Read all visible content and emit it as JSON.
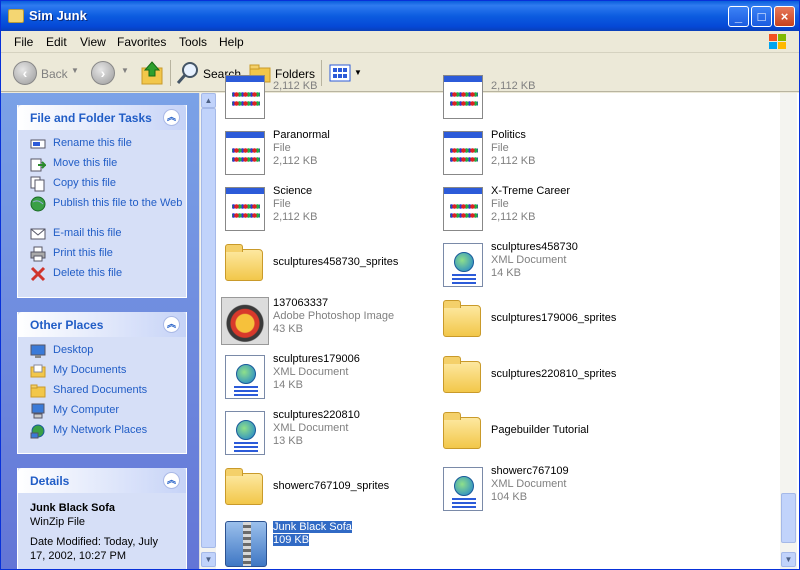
{
  "window": {
    "title": "Sim Junk"
  },
  "menu": [
    "File",
    "Edit",
    "View",
    "Favorites",
    "Tools",
    "Help"
  ],
  "toolbar": {
    "back": "Back",
    "search": "Search",
    "folders": "Folders"
  },
  "tasks_panel": {
    "title": "File and Folder Tasks",
    "items": [
      "Rename this file",
      "Move this file",
      "Copy this file",
      "Publish this file to the Web",
      "E-mail this file",
      "Print this file",
      "Delete this file"
    ]
  },
  "places_panel": {
    "title": "Other Places",
    "items": [
      "Desktop",
      "My Documents",
      "Shared Documents",
      "My Computer",
      "My Network Places"
    ]
  },
  "details_panel": {
    "title": "Details",
    "name": "Junk Black Sofa",
    "type": "WinZip File",
    "modified": "Date Modified: Today, July 17, 2002, 10:27 PM"
  },
  "files": [
    {
      "name": "",
      "type": "",
      "size": "2,112 KB",
      "icon": "exe-icon"
    },
    {
      "name": "",
      "type": "",
      "size": "2,112 KB",
      "icon": "exe-icon"
    },
    {
      "name": "Paranormal",
      "type": "File",
      "size": "2,112 KB",
      "icon": "exe-icon"
    },
    {
      "name": "Politics",
      "type": "File",
      "size": "2,112 KB",
      "icon": "exe-icon"
    },
    {
      "name": "Science",
      "type": "File",
      "size": "2,112 KB",
      "icon": "exe-icon"
    },
    {
      "name": "X-Treme Career",
      "type": "File",
      "size": "2,112 KB",
      "icon": "exe-icon"
    },
    {
      "name": "sculptures458730_sprites",
      "type": "",
      "size": "",
      "icon": "folder-icon"
    },
    {
      "name": "sculptures458730",
      "type": "XML Document",
      "size": "14 KB",
      "icon": "xml-icon"
    },
    {
      "name": "137063337",
      "type": "Adobe Photoshop Image",
      "size": "43 KB",
      "icon": "psd-icon"
    },
    {
      "name": "sculptures179006_sprites",
      "type": "",
      "size": "",
      "icon": "folder-icon"
    },
    {
      "name": "sculptures179006",
      "type": "XML Document",
      "size": "14 KB",
      "icon": "xml-icon"
    },
    {
      "name": "sculptures220810_sprites",
      "type": "",
      "size": "",
      "icon": "folder-icon"
    },
    {
      "name": "sculptures220810",
      "type": "XML Document",
      "size": "13 KB",
      "icon": "xml-icon"
    },
    {
      "name": "Pagebuilder Tutorial",
      "type": "",
      "size": "",
      "icon": "folder-icon"
    },
    {
      "name": "showerc767109_sprites",
      "type": "",
      "size": "",
      "icon": "folder-icon"
    },
    {
      "name": "showerc767109",
      "type": "XML Document",
      "size": "104 KB",
      "icon": "xml-icon"
    },
    {
      "name": "Junk Black Sofa",
      "type": "",
      "size": "109 KB",
      "icon": "zip-icon",
      "selected": true
    }
  ]
}
